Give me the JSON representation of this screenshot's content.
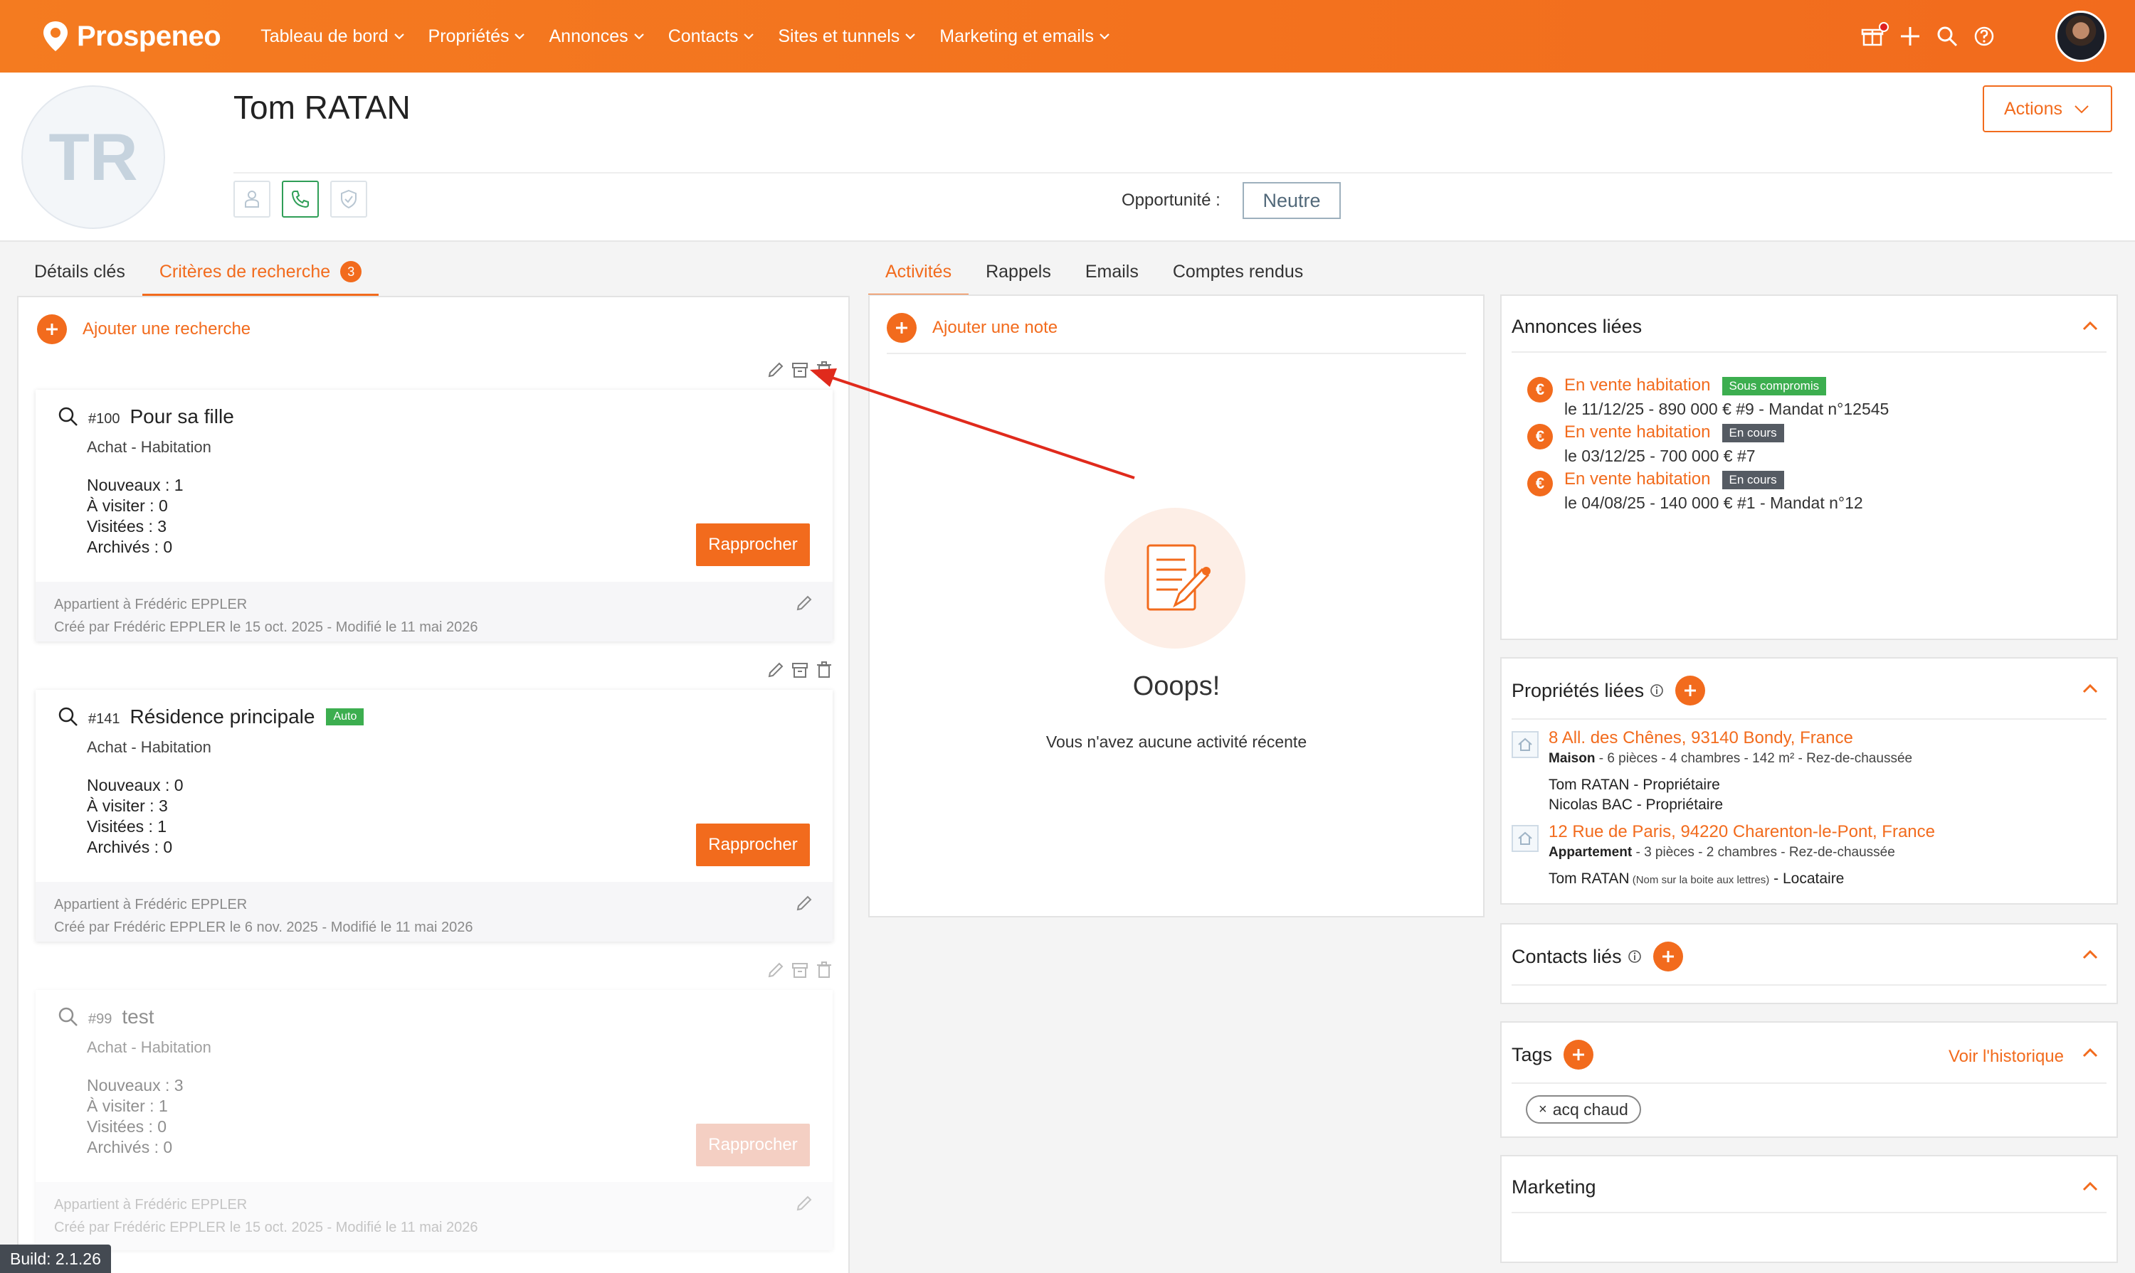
{
  "nav": {
    "brand": "Prospeneo",
    "menu": [
      {
        "label": "Tableau de bord"
      },
      {
        "label": "Propriétés"
      },
      {
        "label": "Annonces"
      },
      {
        "label": "Contacts"
      },
      {
        "label": "Sites et tunnels"
      },
      {
        "label": "Marketing et emails"
      }
    ]
  },
  "header": {
    "initials": "TR",
    "name": "Tom RATAN",
    "actions_label": "Actions",
    "opportunity_label": "Opportunité :",
    "opportunity_value": "Neutre"
  },
  "left_tabs": [
    {
      "label": "Détails clés"
    },
    {
      "label": "Critères de recherche",
      "count": "3"
    }
  ],
  "center_tabs": [
    {
      "label": "Activités"
    },
    {
      "label": "Rappels"
    },
    {
      "label": "Emails"
    },
    {
      "label": "Comptes rendus"
    }
  ],
  "searches": {
    "add_label": "Ajouter une recherche",
    "match_label": "Rapprocher",
    "items": [
      {
        "id": "#100",
        "name": "Pour sa fille",
        "auto": "",
        "type": "Achat - Habitation",
        "stats": [
          "Nouveaux : 1",
          "À visiter : 0",
          "Visitées : 3",
          "Archivés : 0"
        ],
        "owner": "Appartient à Frédéric EPPLER",
        "created": "Créé par Frédéric EPPLER le 15 oct. 2025 - Modifié le 11 mai 2026"
      },
      {
        "id": "#141",
        "name": "Résidence principale",
        "auto": "Auto",
        "type": "Achat - Habitation",
        "stats": [
          "Nouveaux : 0",
          "À visiter : 3",
          "Visitées : 1",
          "Archivés : 0"
        ],
        "owner": "Appartient à Frédéric EPPLER",
        "created": "Créé par Frédéric EPPLER le 6 nov. 2025 - Modifié le 11 mai 2026"
      },
      {
        "id": "#99",
        "name": "test",
        "auto": "",
        "type": "Achat - Habitation",
        "stats": [
          "Nouveaux : 3",
          "À visiter : 1",
          "Visitées : 0",
          "Archivés : 0"
        ],
        "owner": "Appartient à Frédéric EPPLER",
        "created": "Créé par Frédéric EPPLER le 15 oct. 2025 - Modifié le 11 mai 2026"
      }
    ]
  },
  "activities": {
    "add_label": "Ajouter une note",
    "empty_title": "Ooops!",
    "empty_text": "Vous n'avez aucune activité récente"
  },
  "linked_listings": {
    "title": "Annonces liées",
    "items": [
      {
        "label": "En vente habitation",
        "status": "Sous compromis",
        "status_color": "#3cae4f",
        "detail": "le 11/12/25 - 890 000 € #9 - Mandat n°12545"
      },
      {
        "label": "En vente habitation",
        "status": "En cours",
        "status_color": "#555b63",
        "detail": "le 03/12/25 - 700 000 € #7"
      },
      {
        "label": "En vente habitation",
        "status": "En cours",
        "status_color": "#555b63",
        "detail": "le 04/08/25 - 140 000 € #1 - Mandat n°12"
      }
    ]
  },
  "linked_properties": {
    "title": "Propriétés liées",
    "items": [
      {
        "address": "8 All. des Chênes, 93140 Bondy, France",
        "kind": "Maison",
        "specs": " - 6 pièces - 4 chambres - 142 m² - Rez-de-chaussée",
        "people": [
          {
            "name": "Tom RATAN",
            "note": "",
            "role": " - Propriétaire"
          },
          {
            "name": "Nicolas BAC",
            "note": "",
            "role": " - Propriétaire"
          }
        ]
      },
      {
        "address": "12 Rue de Paris, 94220 Charenton-le-Pont, France",
        "kind": "Appartement",
        "specs": " - 3 pièces - 2 chambres - Rez-de-chaussée",
        "people": [
          {
            "name": "Tom RATAN",
            "note": " (Nom sur la boite aux lettres)",
            "role": " - Locataire"
          }
        ]
      }
    ]
  },
  "linked_contacts": {
    "title": "Contacts liés"
  },
  "tags": {
    "title": "Tags",
    "history_label": "Voir l'historique",
    "items": [
      "acq chaud"
    ]
  },
  "marketing": {
    "title": "Marketing"
  },
  "build": "Build: 2.1.26",
  "colors": {
    "accent": "#f26b1d",
    "success": "#3cae4f",
    "dark_badge": "#555b63"
  }
}
